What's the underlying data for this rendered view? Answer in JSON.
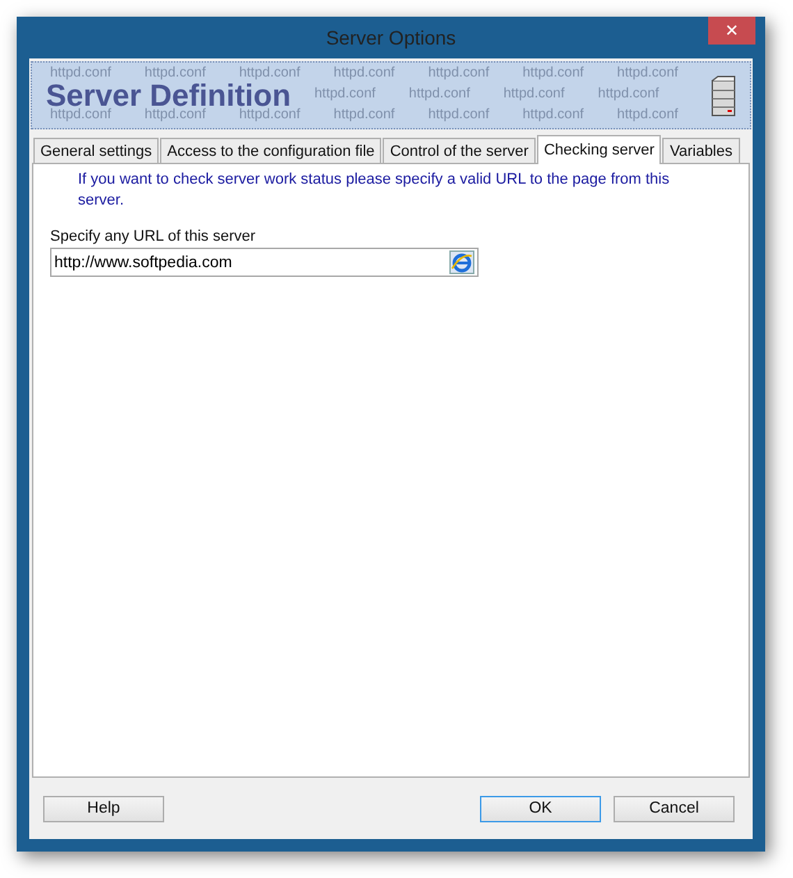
{
  "window": {
    "title": "Server Options",
    "close": "✕"
  },
  "banner": {
    "title": "Server Definition",
    "pattern_rows": [
      [
        "httpd.conf",
        "httpd.conf",
        "httpd.conf",
        "httpd.conf",
        "httpd.conf",
        "httpd.conf",
        "httpd.conf"
      ],
      [
        "httpd.conf",
        "httpd.conf",
        "httpd.conf",
        "httpd.conf"
      ],
      [
        "httpd.conf",
        "httpd.conf",
        "httpd.conf",
        "httpd.conf",
        "httpd.conf",
        "httpd.conf",
        "httpd.conf"
      ]
    ]
  },
  "tabs": [
    {
      "label": "General settings",
      "selected": false
    },
    {
      "label": "Access to the configuration file",
      "selected": false
    },
    {
      "label": "Control of the server",
      "selected": false
    },
    {
      "label": "Checking server",
      "selected": true
    },
    {
      "label": "Variables",
      "selected": false
    }
  ],
  "panel": {
    "info": "If you want to check server work status please specify a valid URL to the page from this server.",
    "url_label": "Specify any URL of this server",
    "url_value": "http://www.softpedia.com"
  },
  "buttons": [
    {
      "label": "Help",
      "kind": "left",
      "default": false
    },
    {
      "label": "OK",
      "kind": "right",
      "default": true
    },
    {
      "label": "Cancel",
      "kind": "right",
      "default": false
    }
  ]
}
